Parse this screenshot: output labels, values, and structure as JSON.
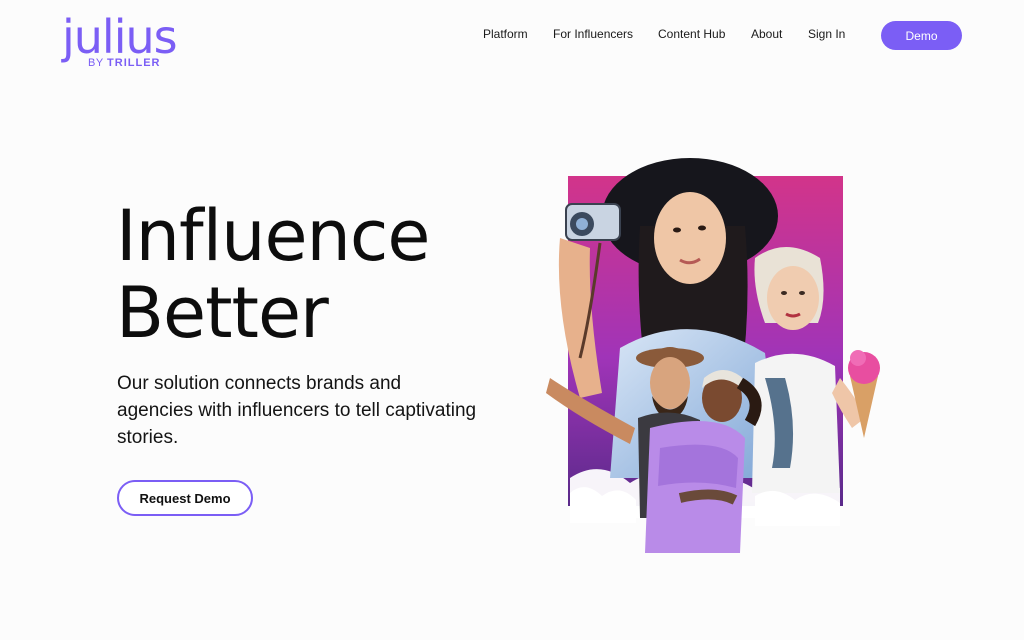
{
  "brand": {
    "logo_word": "julius",
    "logo_by": "BY",
    "logo_company": "TRILLER",
    "accent_color": "#7b5ef5"
  },
  "nav": {
    "items": [
      {
        "label": "Platform"
      },
      {
        "label": "For Influencers"
      },
      {
        "label": "Content Hub"
      },
      {
        "label": "About"
      },
      {
        "label": "Sign In"
      }
    ],
    "demo_label": "Demo"
  },
  "hero": {
    "title_line1": "Influence",
    "title_line2": "Better",
    "subtitle": "Our solution connects brands and agencies with influencers to tell captivating stories.",
    "cta_label": "Request Demo"
  }
}
